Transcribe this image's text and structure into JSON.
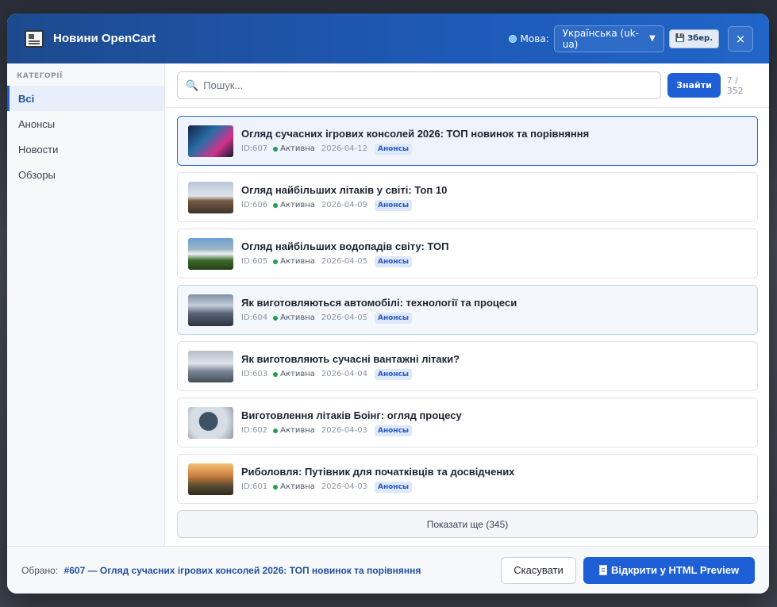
{
  "header": {
    "title": "Новини OpenCart",
    "language_label": "Мова:",
    "language_value": "Українська (uk-ua)",
    "save_label": "Збер.",
    "close_label": "×"
  },
  "sidebar": {
    "heading": "КАТЕГОРІЇ",
    "items": [
      {
        "label": "Всі",
        "active": true
      },
      {
        "label": "Анонсы",
        "active": false
      },
      {
        "label": "Новости",
        "active": false
      },
      {
        "label": "Обзоры",
        "active": false
      }
    ]
  },
  "search": {
    "placeholder": "Пошук...",
    "button_label": "Знайти",
    "count": "7 / 352"
  },
  "articles": [
    {
      "title": "Огляд сучасних ігрових консолей 2026: ТОП новинок та порівняння",
      "id": "ID:607",
      "status": "Активна",
      "date": "2026-04-12",
      "tag": "Анонсы"
    },
    {
      "title": "Огляд найбільших літаків у світі: Топ 10",
      "id": "ID:606",
      "status": "Активна",
      "date": "2026-04-09",
      "tag": "Анонсы"
    },
    {
      "title": "Огляд найбільших водопадів світу: ТОП",
      "id": "ID:605",
      "status": "Активна",
      "date": "2026-04-05",
      "tag": "Анонсы"
    },
    {
      "title": "Як виготовляються автомобілі: технології та процеси",
      "id": "ID:604",
      "status": "Активна",
      "date": "2026-04-05",
      "tag": "Анонсы"
    },
    {
      "title": "Як виготовляють сучасні вантажні літаки?",
      "id": "ID:603",
      "status": "Активна",
      "date": "2026-04-04",
      "tag": "Анонсы"
    },
    {
      "title": "Виготовлення літаків Боінг: огляд процесу",
      "id": "ID:602",
      "status": "Активна",
      "date": "2026-04-03",
      "tag": "Анонсы"
    },
    {
      "title": "Риболовля: Путівник для початківців та досвідчених",
      "id": "ID:601",
      "status": "Активна",
      "date": "2026-04-03",
      "tag": "Анонсы"
    }
  ],
  "more_label": "Показати ще (345)",
  "footer": {
    "chosen_label": "Обрано:",
    "chosen_value": "#607 — Огляд сучасних ігрових консолей 2026: ТОП новинок та порівняння",
    "cancel_label": "Скасувати",
    "open_label": "Відкрити у HTML Preview"
  },
  "colors": {
    "header": "#1e5ab8",
    "accent": "#1f5fd6",
    "active_dot": "#22a04a"
  }
}
